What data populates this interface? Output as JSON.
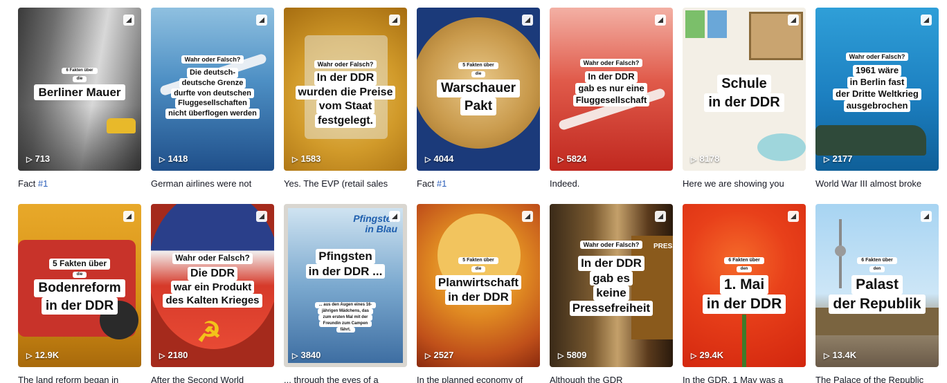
{
  "cards": [
    {
      "overlay": [
        "6 Fakten über",
        "die",
        "Berliner Mauer"
      ],
      "views": "713",
      "caption": "Fact ",
      "caption_tag": "#1"
    },
    {
      "overlay": [
        "Wahr oder Falsch?",
        "Die deutsch-",
        "deutsche Grenze",
        "durfte von deutschen",
        "Fluggesellschaften",
        "nicht überflogen werden"
      ],
      "views": "1418",
      "caption": "German airlines were not"
    },
    {
      "overlay": [
        "Wahr oder Falsch?",
        "In der DDR",
        "wurden die Preise",
        "vom Staat",
        "festgelegt."
      ],
      "views": "1583",
      "caption": "Yes. The EVP (retail sales"
    },
    {
      "overlay": [
        "5 Fakten über",
        "die",
        "Warschauer",
        "Pakt"
      ],
      "views": "4044",
      "caption": "Fact ",
      "caption_tag": "#1"
    },
    {
      "overlay": [
        "Wahr oder Falsch?",
        "In der DDR",
        "gab es nur eine",
        "Fluggesellschaft"
      ],
      "views": "5824",
      "caption": "Indeed."
    },
    {
      "overlay": [
        "Schule",
        "in der DDR"
      ],
      "views": "8178",
      "caption": "Here we are showing you"
    },
    {
      "overlay": [
        "Wahr oder Falsch?",
        "1961 wäre",
        "in Berlin fast",
        "der Dritte Weltkrieg",
        "ausgebrochen"
      ],
      "views": "2177",
      "caption": "World War III almost broke"
    },
    {
      "overlay": [
        "5 Fakten über",
        "die",
        "Bodenreform",
        "in der DDR"
      ],
      "views": "12.9K",
      "caption": "The land reform began in"
    },
    {
      "overlay": [
        "Wahr oder Falsch?",
        "Die DDR",
        "war ein Produkt",
        "des Kalten Krieges"
      ],
      "views": "2180",
      "caption": "After the Second World"
    },
    {
      "overlay": [
        "Pfingsten",
        "in der DDR ...",
        "... aus den Augen eines 16-",
        "jährigen Mädchens, das",
        "zum ersten Mal mit der",
        "Freundin zum Campen",
        "fährt."
      ],
      "views": "3840",
      "caption": "... through the eyes of a",
      "poster_title": [
        "Pfingsten",
        "in Blau"
      ]
    },
    {
      "overlay": [
        "5 Fakten über",
        "die",
        "Planwirtschaft",
        "in der DDR"
      ],
      "views": "2527",
      "caption": "In the planned economy of"
    },
    {
      "overlay": [
        "Wahr oder Falsch?",
        "In der DDR",
        "gab es",
        "keine",
        "Pressefreiheit"
      ],
      "views": "5809",
      "caption": "Although the GDR",
      "sign": "PRESS"
    },
    {
      "overlay": [
        "6 Fakten über",
        "den",
        "1. Mai",
        "in der DDR"
      ],
      "views": "29.4K",
      "caption": "In the GDR, 1 May was a"
    },
    {
      "overlay": [
        "6 Fakten über",
        "den",
        "Palast",
        "der Republik"
      ],
      "views": "13.4K",
      "caption": "The Palace of the Republic"
    }
  ]
}
